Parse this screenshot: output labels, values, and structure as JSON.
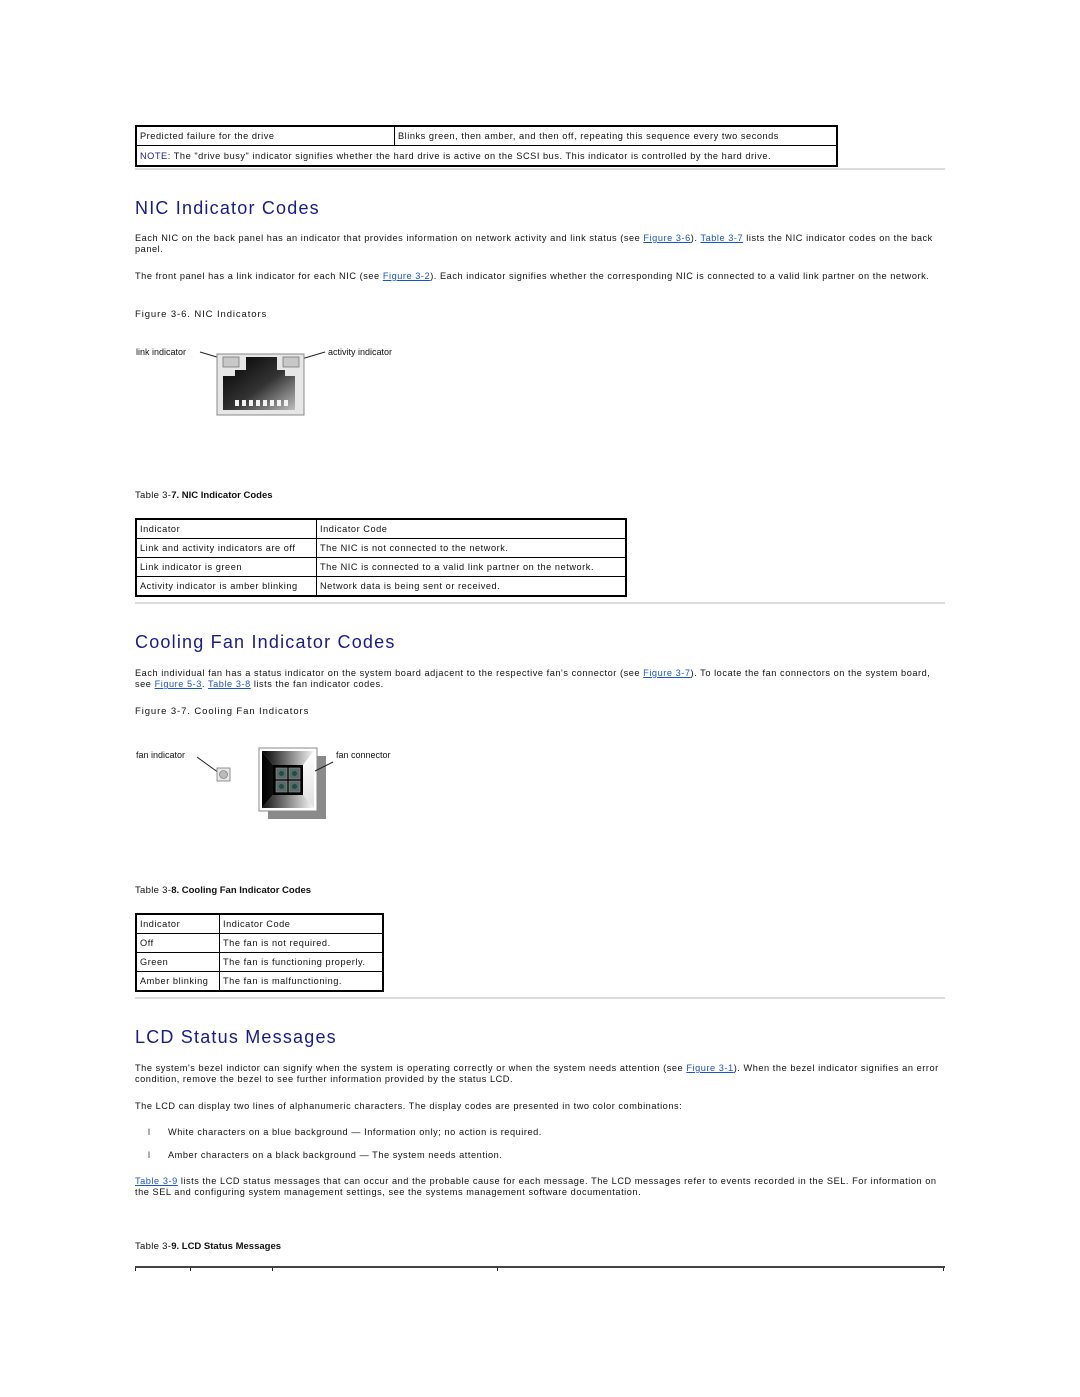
{
  "top_table": {
    "rows": [
      {
        "indicator": "Predicted failure for the drive",
        "code": "Blinks green, then amber, and then off, repeating this sequence every two seconds"
      }
    ],
    "note_label": "NOTE:",
    "note_text": " The \"drive busy\" indicator signifies whether the hard drive is active on the SCSI bus. This indicator is controlled by the hard drive."
  },
  "nic": {
    "heading": "NIC Indicator Codes",
    "para1": {
      "before": "Each NIC on the back panel has an indicator that provides information on network activity and link status (see ",
      "link1": "Figure 3-6",
      "middle": "). ",
      "link2": "Table 3-7",
      "after": " lists the NIC indicator codes on the back panel."
    },
    "para2": {
      "before": "The front panel has a link indicator for each NIC (see ",
      "link1": "Figure 3-2",
      "after": "). Each indicator signifies whether the corresponding NIC is connected to a valid link partner on the network."
    },
    "figure_caption": "Figure 3-6. NIC Indicators",
    "figure_labels": {
      "left": "link indicator",
      "right": "activity indicator"
    },
    "table_caption_prefix": "Table 3-",
    "table_caption_bold": "7. NIC Indicator Codes",
    "table": {
      "headers": [
        "Indicator",
        "Indicator Code"
      ],
      "rows": [
        [
          "Link and activity indicators are off",
          "The NIC is not connected to the network."
        ],
        [
          "Link indicator is green",
          "The NIC is connected to a valid link partner on the network."
        ],
        [
          "Activity indicator is amber blinking",
          "Network data is being sent or received."
        ]
      ]
    }
  },
  "fan": {
    "heading": "Cooling Fan Indicator Codes",
    "para1": {
      "before": "Each individual fan has a status indicator on the system board adjacent to the respective fan's connector (see ",
      "link1": "Figure 3-7",
      "middle1": "). To locate the fan connectors on the system board, see ",
      "link2": "Figure 5-3",
      "middle2": ". ",
      "link3": "Table 3-8",
      "after": " lists the fan indicator codes."
    },
    "figure_caption": "Figure 3-7. Cooling Fan Indicators",
    "figure_labels": {
      "left": "fan indicator",
      "right": "fan connector"
    },
    "table_caption_prefix": "Table 3-",
    "table_caption_bold": "8. Cooling Fan Indicator Codes",
    "table": {
      "headers": [
        "Indicator",
        "Indicator Code"
      ],
      "rows": [
        [
          "Off",
          "The fan is not required."
        ],
        [
          "Green",
          "The fan is functioning properly."
        ],
        [
          "Amber blinking",
          "The fan is malfunctioning."
        ]
      ]
    }
  },
  "lcd": {
    "heading": "LCD Status Messages",
    "para1": {
      "before": "The system's bezel indictor can signify when the system is operating correctly or when the system needs attention (see ",
      "link1": "Figure 3-1",
      "after": "). When the bezel indicator signifies an error condition, remove the bezel to see further information provided by the status LCD."
    },
    "para2": "The LCD can display two lines of alphanumeric characters. The display codes are presented in two color combinations:",
    "bullet_glyph": "l",
    "bullets": [
      "White characters on a blue background — Information only; no action is required.",
      "Amber characters on a black background — The system needs attention."
    ],
    "para3": {
      "link1": "Table 3-9",
      "after": " lists the LCD status messages that can occur and the probable cause for each message. The LCD messages refer to events recorded in the SEL. For information on the SEL and configuring system management settings, see the systems management software documentation."
    },
    "table_caption_prefix": "Table 3-",
    "table_caption_bold": "9. LCD Status Messages"
  },
  "colors": {
    "heading": "#1a1a8c",
    "link": "#1a55c8",
    "rule": "#dcdcdc"
  }
}
